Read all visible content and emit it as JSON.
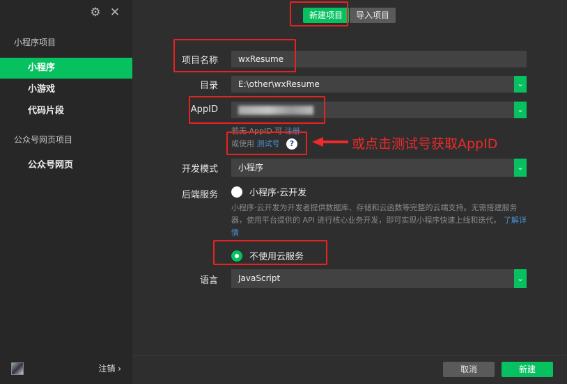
{
  "sidebar": {
    "section_mini": "小程序项目",
    "items": [
      {
        "label": "小程序"
      },
      {
        "label": "小游戏"
      },
      {
        "label": "代码片段"
      }
    ],
    "section_oa": "公众号网页项目",
    "oa_item": "公众号网页",
    "logout": "注销 ›"
  },
  "tabs": {
    "new": "新建项目",
    "import": "导入项目"
  },
  "form": {
    "project_name_label": "项目名称",
    "project_name_value": "wxResume",
    "dir_label": "目录",
    "dir_value": "E:\\other\\wxResume",
    "appid_label": "AppID",
    "appid_hint_prefix": "若无 AppID 可",
    "appid_hint_link": "注册",
    "appid_alt_prefix": "或使用",
    "appid_alt_link": "测试号",
    "help": "?",
    "dev_mode_label": "开发模式",
    "dev_mode_value": "小程序",
    "backend_label": "后端服务",
    "cloud_option": "小程序·云开发",
    "cloud_desc": "小程序·云开发为开发者提供数据库、存储和云函数等完整的云端支持。无需搭建服务器，使用平台提供的 API 进行核心业务开发，即可实现小程序快速上线和迭代。",
    "cloud_desc_link": "了解详情",
    "no_cloud_option": "不使用云服务",
    "lang_label": "语言",
    "lang_value": "JavaScript"
  },
  "annotation": "或点击测试号获取AppID",
  "footer": {
    "cancel": "取消",
    "create": "新建"
  },
  "colors": {
    "accent": "#07c160",
    "annotation": "#e8231f"
  }
}
